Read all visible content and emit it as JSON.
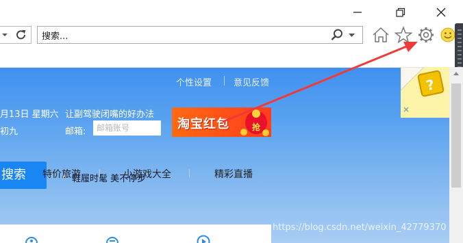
{
  "toolbar": {
    "address_text": "搜索...",
    "refresh_icon": "refresh-icon",
    "search_icon": "search-icon",
    "home_icon": "home-icon",
    "favorites_icon": "star-icon",
    "tools_icon": "gear-icon",
    "feedback_icon": "smiley-icon"
  },
  "page": {
    "links": {
      "personalize": "个性设置",
      "feedback": "意见反馈"
    },
    "date_line1": "月13日 星期六",
    "date_line2": "初九",
    "promo_text": "让副驾驶闭嘴的好办法",
    "email_label": "邮箱:",
    "email_placeholder": "邮箱账号",
    "banner_text": "淘宝红包",
    "banner_button": "抢",
    "search_button": "搜索",
    "hot_text": "鞋履时髦 美不停步",
    "bottom_nav": [
      "特价旅游",
      "小游戏大全",
      "精彩直播"
    ]
  },
  "watermark": "https://blog.csdn.net/weixin_42779370",
  "colors": {
    "page_blue": "#3f91f0",
    "search_blue": "#1a86f4",
    "arrow_red": "#f03a3a"
  }
}
